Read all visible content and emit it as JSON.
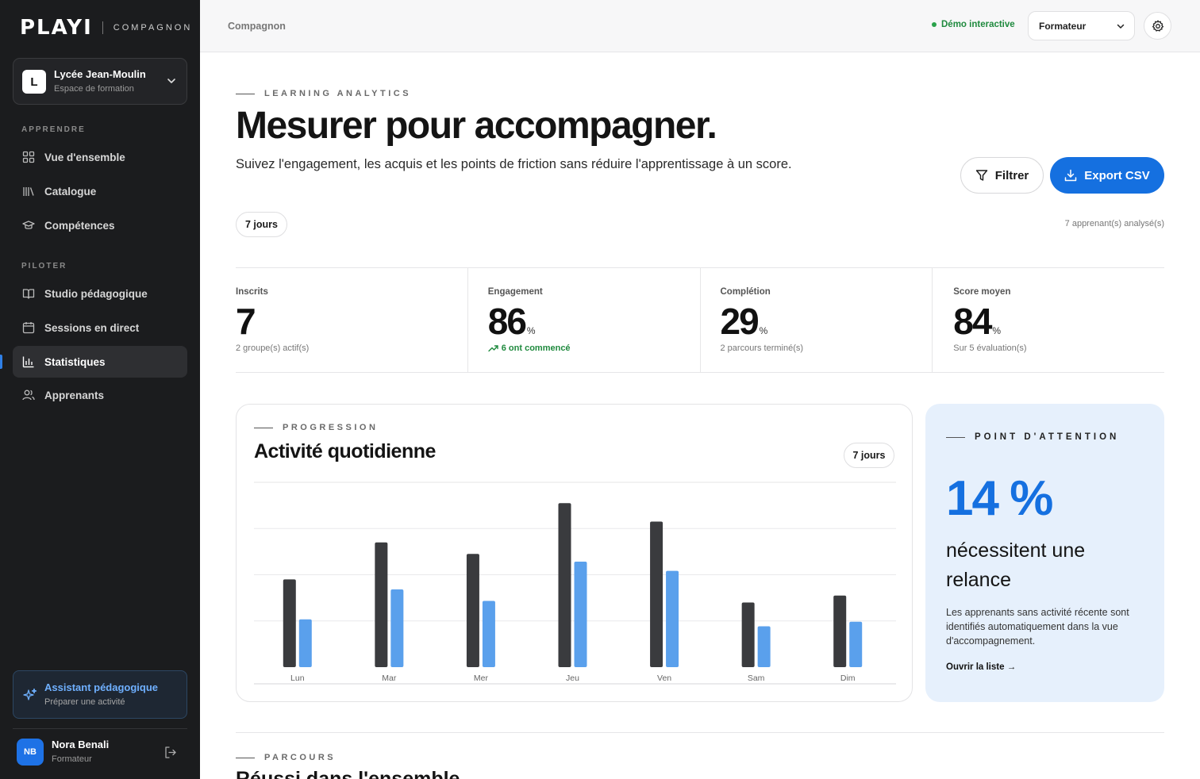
{
  "brand": {
    "logo": "PLAYI",
    "product": "COMPAGNON"
  },
  "org": {
    "initial": "L",
    "name": "Lycée Jean-Moulin",
    "sub": "Espace de formation"
  },
  "nav": {
    "section_learn": "APPRENDRE",
    "section_pilot": "PILOTER",
    "items": [
      {
        "label": "Vue d'ensemble",
        "icon": "grid-icon"
      },
      {
        "label": "Catalogue",
        "icon": "books-icon"
      },
      {
        "label": "Compétences",
        "icon": "graduation-cap-icon"
      },
      {
        "label": "Studio pédagogique",
        "icon": "book-open-icon"
      },
      {
        "label": "Sessions en direct",
        "icon": "calendar-icon"
      },
      {
        "label": "Statistiques",
        "icon": "bar-chart-icon",
        "active": true
      },
      {
        "label": "Apprenants",
        "icon": "users-icon"
      }
    ]
  },
  "assistant": {
    "title": "Assistant pédagogique",
    "sub": "Préparer une activité"
  },
  "user": {
    "initials": "NB",
    "name": "Nora Benali",
    "role": "Formateur"
  },
  "topbar": {
    "breadcrumb": "Compagnon",
    "demo": "Démo interactive",
    "role": "Formateur"
  },
  "header": {
    "eyebrow": "LEARNING ANALYTICS",
    "title": "Mesurer pour accompagner.",
    "description": "Suivez l'engagement, les acquis et les points de friction sans réduire l'apprentissage à un score.",
    "filter": "Filtrer",
    "export": "Export CSV",
    "period": "7 jours",
    "analysed": "7 apprenant(s) analysé(s)"
  },
  "kpis": [
    {
      "label": "Inscrits",
      "value": "7",
      "unit": "",
      "sub": "2 groupe(s) actif(s)"
    },
    {
      "label": "Engagement",
      "value": "86",
      "unit": "%",
      "sub": "6 ont commencé"
    },
    {
      "label": "Complétion",
      "value": "29",
      "unit": "%",
      "sub": "2 parcours terminé(s)"
    },
    {
      "label": "Score moyen",
      "value": "84",
      "unit": "%",
      "sub": "Sur 5 évaluation(s)"
    }
  ],
  "chart": {
    "eyebrow": "PROGRESSION",
    "title": "Activité quotidienne",
    "period": "7 jours"
  },
  "chart_data": {
    "type": "bar",
    "categories": [
      "Lun",
      "Mar",
      "Mer",
      "Jeu",
      "Ven",
      "Sam",
      "Dim"
    ],
    "series": [
      {
        "values": [
          114,
          162,
          147,
          213,
          189,
          84,
          93
        ],
        "color": "#3a3b3e"
      },
      {
        "values": [
          62,
          101,
          86,
          137,
          125,
          53,
          59
        ],
        "color": "#5aa0ec"
      }
    ],
    "ylim": [
      0,
      240
    ],
    "grid": true
  },
  "attention": {
    "eyebrow": "POINT D'ATTENTION",
    "value": "14 %",
    "headline": "nécessitent une relance",
    "text": "Les apprenants sans activité récente sont identifiés automatiquement dans la vue d'accompagnement.",
    "link": "Ouvrir la liste →"
  },
  "parcours": {
    "eyebrow": "PARCOURS",
    "title": "Réussi dans l'ensemble"
  }
}
